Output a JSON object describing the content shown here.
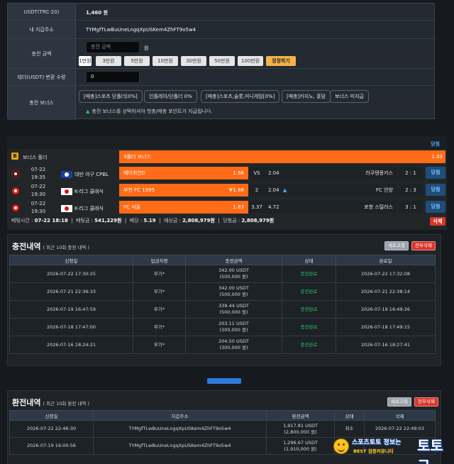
{
  "charge_form": {
    "rows": [
      {
        "label": "USDT(TRC-20)",
        "value": "1,460 원"
      },
      {
        "label": "내 지갑주소",
        "value": "TYMgfTLwBuUneLngqXpUSKem4ZhFT9o5w4"
      },
      {
        "label": "충전 금액",
        "input_placeholder": "충전 금액",
        "unit": "원"
      },
      {
        "label": "테더(USDT) 변환 수량",
        "input_value": "0"
      },
      {
        "label": "충전 보너스"
      }
    ],
    "amount_chips": [
      "1만원",
      "3만원",
      "5만원",
      "10만원",
      "30만원",
      "50만원",
      "100만원"
    ],
    "reset_label": "정정하기",
    "bonus_options": [
      "[매충]스포츠 단폴더[0%]",
      "인플레이/단폴더 0%",
      "[매충]스포츠,슬롯,미니게임[0%]",
      "[매충]카지노, 홀덤",
      "보너스 미지급"
    ],
    "bonus_note": "충전 보너스를 선택하셔야 첫충/매충 포인트가 지급됩니다."
  },
  "bet_slip": {
    "top_link": "당첨",
    "bonus_row": {
      "label": "보너스 폴더",
      "name": "3폴더 보너스",
      "odds": "1.03"
    },
    "matches": [
      {
        "date": "07-22",
        "time": "19:35",
        "league": "대만 야구 CPBL",
        "home": "웨이취안D",
        "home_odds": "1.66",
        "draw": "VS",
        "away_odds": "2.04",
        "away": "라쿠텐몽키스",
        "score": "2 : 1",
        "result": "당첨"
      },
      {
        "date": "07-22",
        "time": "19:30",
        "league": "K-리그 클래식",
        "home": "부천 FC 1995",
        "home_odds": "1.66",
        "draw": "2",
        "away_odds": "2.04",
        "away": "FC 안양",
        "score": "2 : 3",
        "result": "당첨"
      },
      {
        "date": "07-22",
        "time": "19:30",
        "league": "K-리그 클래식",
        "home": "FC 서울",
        "home_odds": "1.83",
        "draw": "3.37",
        "away_odds": "4.72",
        "away": "포항 스틸러스",
        "score": "3 : 1",
        "result": "당첨"
      }
    ],
    "summary": {
      "bet_time_label": "베팅시간 :",
      "bet_time": "07-22 18:18",
      "bet_amount_label": "베팅금 :",
      "bet_amount": "541,229원",
      "odds_label": "배당 :",
      "odds": "5.19",
      "expected_label": "예상금 :",
      "expected": "2,808,979원",
      "win_label": "당첨금 :",
      "win": "2,808,979원"
    },
    "delete_label": "삭제"
  },
  "charge_history": {
    "title": "충전내역",
    "subtitle": "( 최근 10회 충전 내역 )",
    "refresh_label": "새로고침",
    "delete_all_label": "전부삭제",
    "columns": [
      "신청일",
      "입금자명",
      "충전금액",
      "상태",
      "완료일"
    ],
    "rows": [
      {
        "date": "2026-07-22 17:30:25",
        "name": "무기*",
        "usdt": "342.00 USDT",
        "krw": "(500,000 원)",
        "status": "충전완료",
        "done": "2026-07-22 17:32:08"
      },
      {
        "date": "2026-07-21 22:36:33",
        "name": "무기*",
        "usdt": "342.00 USDT",
        "krw": "(500,000 원)",
        "status": "충전완료",
        "done": "2026-07-21 22:38:14"
      },
      {
        "date": "2026-07-19 16:47:59",
        "name": "무기*",
        "usdt": "339.44 USDT",
        "krw": "(500,000 원)",
        "status": "충전완료",
        "done": "2026-07-19 16:49:26"
      },
      {
        "date": "2026-07-18 17:47:00",
        "name": "무기*",
        "usdt": "203.11 USDT",
        "krw": "(300,000 원)",
        "status": "충전완료",
        "done": "2026-07-18 17:49:15"
      },
      {
        "date": "2026-07-16 18:24:21",
        "name": "무기*",
        "usdt": "204.50 USDT",
        "krw": "(300,000 원)",
        "status": "충전완료",
        "done": "2026-07-16 18:27:41"
      }
    ]
  },
  "exchange_history": {
    "title": "환전내역",
    "subtitle": "( 최근 10회 환전 내역 )",
    "refresh_label": "새로고침",
    "delete_all_label": "전부삭제",
    "columns": [
      "신청일",
      "지갑주소",
      "환전금액",
      "상태",
      "삭제"
    ],
    "rows": [
      {
        "date": "2026-07-22 22:46:30",
        "wallet": "TYMgfTLwBuUneLngqXpUSKem4ZhFT9o5w4",
        "usdt": "1,917.81 USDT",
        "krw": "(2,800,000 원)",
        "status": "취소",
        "extra": "2026-07-22 22:49:03"
      },
      {
        "date": "2026-07-19 16:00:56",
        "wallet": "TYMgfTLwBuUneLngqXpUSKem4ZhFT9o5w4",
        "usdt": "1,296.67 USDT",
        "krw": "(1,910,000 원)",
        "status": "",
        "extra": ""
      }
    ]
  },
  "watermark": {
    "line1": "스포츠토토 정보는",
    "line2": "BEST 검증커뮤니티",
    "big": "토토군"
  },
  "colors": {
    "accent_orange": "#ff6b16",
    "win_blue": "#49a6ff",
    "ok_green": "#2fc15f",
    "danger_red": "#d9362b",
    "reset_yellow": "#f2b34a"
  }
}
